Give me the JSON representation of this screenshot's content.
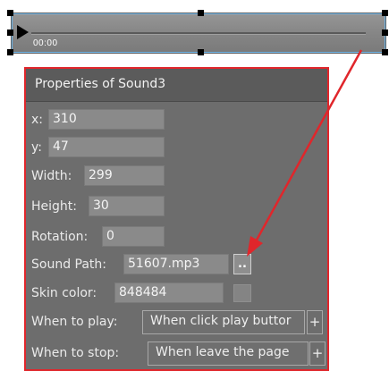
{
  "player": {
    "time": "00:00"
  },
  "panel": {
    "title": "Properties of Sound3",
    "x": {
      "label": "x:",
      "value": "310"
    },
    "y": {
      "label": "y:",
      "value": "47"
    },
    "width": {
      "label": "Width:",
      "value": "299"
    },
    "height": {
      "label": "Height:",
      "value": "30"
    },
    "rotation": {
      "label": "Rotation:",
      "value": "0"
    },
    "sound_path": {
      "label": "Sound Path:",
      "value": "51607.mp3",
      "browse_label": ".."
    },
    "skin_color": {
      "label": "Skin color:",
      "value": "848484",
      "swatch_color": "#848484"
    },
    "when_to_play": {
      "label": "When to play:",
      "value": "When click play buttor",
      "add_label": "+"
    },
    "when_to_stop": {
      "label": "When to stop:",
      "value": "When leave the page",
      "add_label": "+"
    }
  },
  "colors": {
    "highlight_red": "#e0262b",
    "selection_blue": "#6fb6e8"
  }
}
